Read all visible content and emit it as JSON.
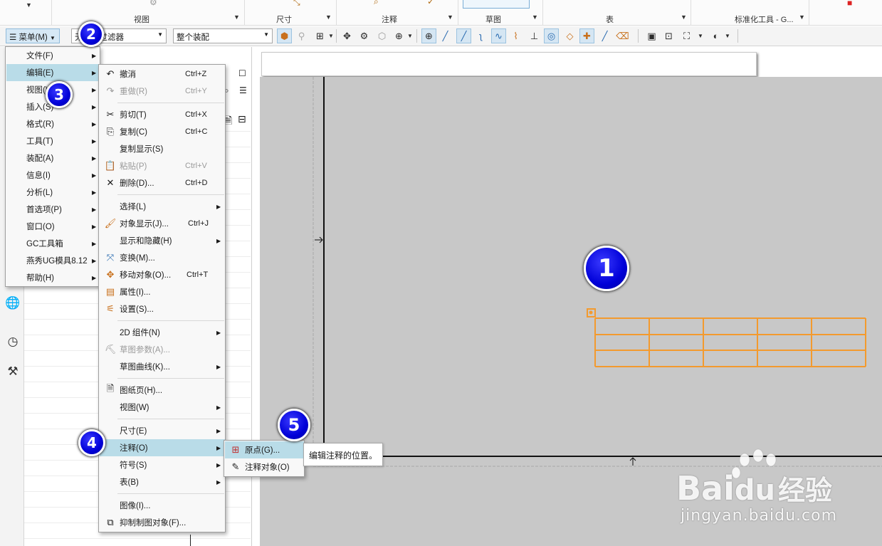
{
  "ribbon": {
    "groups": [
      {
        "label": "视图"
      },
      {
        "label": "尺寸"
      },
      {
        "label": "注释"
      },
      {
        "label": "草图"
      },
      {
        "label": "表"
      },
      {
        "label": "标准化工具 - G..."
      }
    ]
  },
  "toolbar": {
    "menu_label": "菜单(M)",
    "filter_value": "无选择过滤器",
    "filter_visible": "滤器",
    "assembly_value": "整个装配"
  },
  "main_menu": {
    "items": [
      {
        "label": "文件(F)"
      },
      {
        "label": "编辑(E)"
      },
      {
        "label": "视图(V)"
      },
      {
        "label": "插入(S)"
      },
      {
        "label": "格式(R)"
      },
      {
        "label": "工具(T)"
      },
      {
        "label": "装配(A)"
      },
      {
        "label": "信息(I)"
      },
      {
        "label": "分析(L)"
      },
      {
        "label": "首选项(P)"
      },
      {
        "label": "窗口(O)"
      },
      {
        "label": "GC工具箱"
      },
      {
        "label": "燕秀UG模具8.12"
      },
      {
        "label": "帮助(H)"
      }
    ]
  },
  "edit_menu": {
    "items": [
      {
        "label": "撤消",
        "shortcut": "Ctrl+Z"
      },
      {
        "label": "重做(R)",
        "shortcut": "Ctrl+Y"
      },
      {
        "label": "剪切(T)",
        "shortcut": "Ctrl+X"
      },
      {
        "label": "复制(C)",
        "shortcut": "Ctrl+C"
      },
      {
        "label": "复制显示(S)",
        "shortcut": ""
      },
      {
        "label": "粘贴(P)",
        "shortcut": "Ctrl+V"
      },
      {
        "label": "删除(D)...",
        "shortcut": "Ctrl+D"
      },
      {
        "label": "选择(L)",
        "shortcut": ""
      },
      {
        "label": "对象显示(J)...",
        "shortcut": "Ctrl+J"
      },
      {
        "label": "显示和隐藏(H)",
        "shortcut": ""
      },
      {
        "label": "变换(M)...",
        "shortcut": ""
      },
      {
        "label": "移动对象(O)...",
        "shortcut": "Ctrl+T"
      },
      {
        "label": "属性(I)...",
        "shortcut": ""
      },
      {
        "label": "设置(S)...",
        "shortcut": ""
      },
      {
        "label": "2D 组件(N)",
        "shortcut": ""
      },
      {
        "label": "草图参数(A)...",
        "shortcut": ""
      },
      {
        "label": "草图曲线(K)...",
        "shortcut": ""
      },
      {
        "label": "图纸页(H)...",
        "shortcut": ""
      },
      {
        "label": "视图(W)",
        "shortcut": ""
      },
      {
        "label": "尺寸(E)",
        "shortcut": ""
      },
      {
        "label": "注释(O)",
        "shortcut": ""
      },
      {
        "label": "符号(S)",
        "shortcut": ""
      },
      {
        "label": "表(B)",
        "shortcut": ""
      },
      {
        "label": "图像(I)...",
        "shortcut": ""
      },
      {
        "label": "抑制制图对象(F)...",
        "shortcut": ""
      }
    ]
  },
  "annotation_menu": {
    "items": [
      {
        "label": "原点(G)..."
      },
      {
        "label": "注释对象(O)"
      }
    ]
  },
  "tooltip": {
    "text": "编辑注释的位置。"
  },
  "badges": {
    "b1": "1",
    "b2": "2",
    "b3": "3",
    "b4": "4",
    "b5": "5"
  },
  "watermark": {
    "brand": "Bai",
    "brand_du": "du",
    "brand_cn": "经验",
    "url": "jingyan.baidu.com"
  },
  "colors": {
    "accent_blue": "#0000d8",
    "menu_highlight": "#b9dce8",
    "table_orange": "#f39a2e",
    "sheet_gray": "#c8c8c8"
  }
}
